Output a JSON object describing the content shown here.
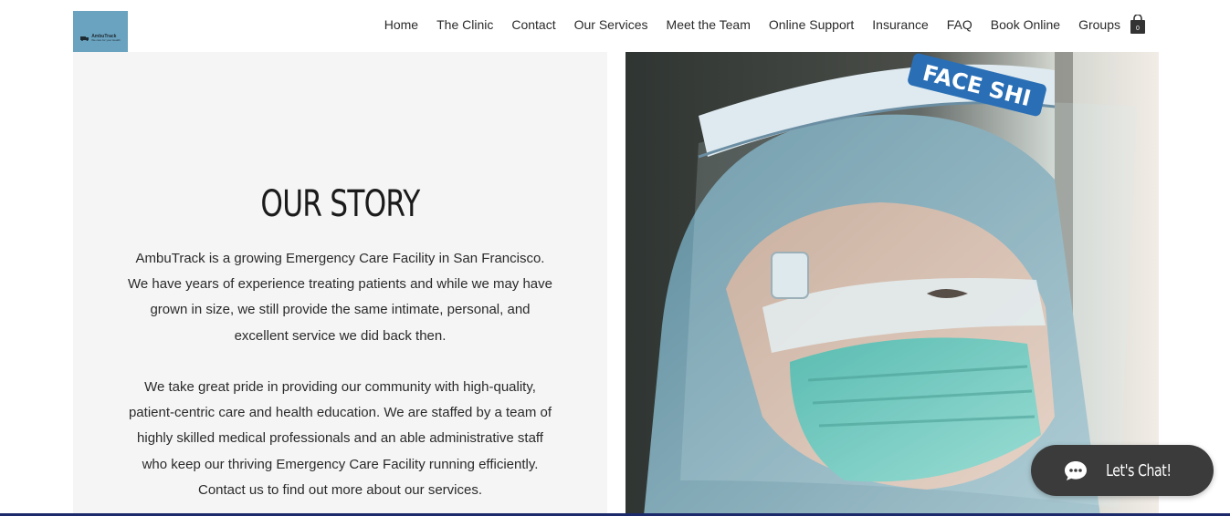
{
  "logo": {
    "name": "AmbuTrack",
    "tagline": "We care for your Health",
    "bg_color": "#6aa3bf"
  },
  "nav": {
    "items": [
      {
        "label": "Home"
      },
      {
        "label": "The Clinic"
      },
      {
        "label": "Contact"
      },
      {
        "label": "Our Services"
      },
      {
        "label": "Meet the Team"
      },
      {
        "label": "Online Support"
      },
      {
        "label": "Insurance"
      },
      {
        "label": "FAQ"
      },
      {
        "label": "Book Online"
      },
      {
        "label": "Groups"
      }
    ],
    "cart_icon": "shopping-bag-icon",
    "cart_count": "0"
  },
  "story": {
    "title": "OUR STORY",
    "paragraph1": "AmbuTrack is a growing Emergency Care Facility in San Francisco. We have years of experience treating patients and while we may have grown in size, we still provide the same intimate, personal, and excellent service we did back then.",
    "paragraph2": "We take great pride in providing our community with high-quality, patient-centric care and health education. We are staffed by a team of highly skilled medical professionals and an able administrative staff who keep our thriving Emergency Care Facility running efficiently. Contact us to find out more about our services.",
    "panel_color": "#f5f5f5"
  },
  "photo": {
    "subject": "healthcare-worker-with-face-shield-photo",
    "shield_text": "FACE SHI"
  },
  "chat": {
    "label": "Let's Chat!",
    "icon": "chat-bubble-icon",
    "bg_color": "#3b3b3b"
  }
}
